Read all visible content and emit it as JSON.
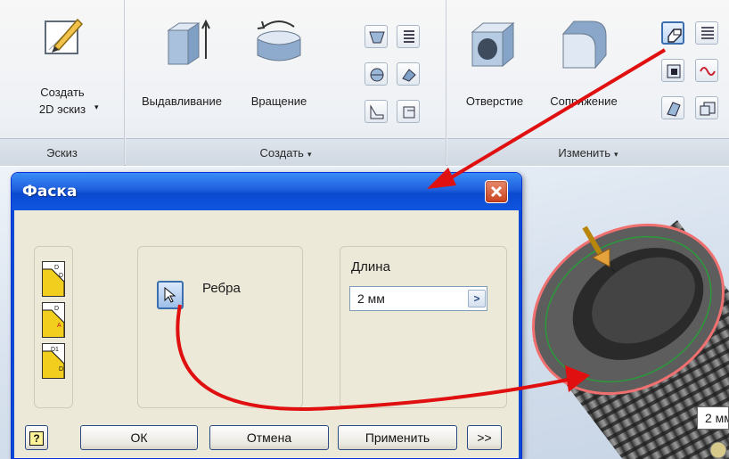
{
  "ribbon": {
    "sketch": {
      "create_line1": "Создать",
      "create_line2": "2D эскиз",
      "group": "Эскиз"
    },
    "create": {
      "extrude": "Выдавливание",
      "revolve": "Вращение",
      "group": "Создать"
    },
    "modify": {
      "hole": "Отверстие",
      "fillet": "Сопряжение",
      "group": "Изменить"
    },
    "dropdown_glyph": "▾"
  },
  "dialog": {
    "title": "Фаска",
    "edges_label": "Ребра",
    "length_label": "Длина",
    "length_value": "2 мм",
    "length_arrow": ">",
    "help": "?",
    "ok": "ОК",
    "cancel": "Отмена",
    "apply": "Применить",
    "more": ">>"
  },
  "viewport": {
    "dimension_tag": "2 мм"
  },
  "annotation": {
    "arrow_color": "#e01010"
  }
}
